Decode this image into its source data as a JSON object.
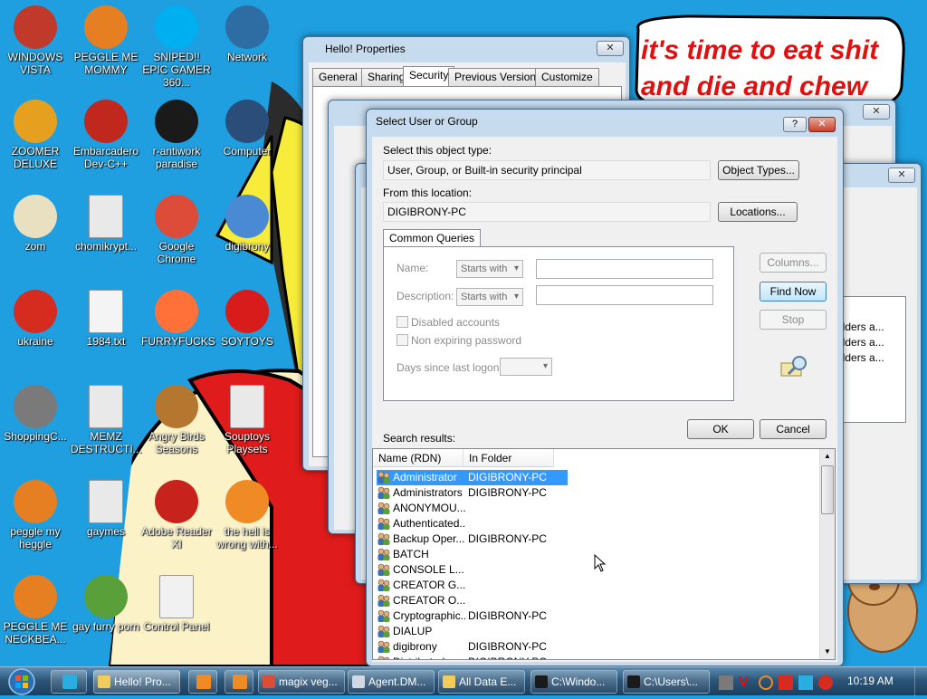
{
  "desktop_icons": [
    {
      "label": "WINDOWS VISTA",
      "icon": "vista-orb-icon",
      "color": "#c0392b"
    },
    {
      "label": "PEGGLE ME MOMMY",
      "icon": "peggle-icon",
      "color": "#e67e22"
    },
    {
      "label": "SNIPED!! EPIC GAMER 360...",
      "icon": "skype-icon",
      "color": "#00aff0"
    },
    {
      "label": "Network",
      "icon": "network-globe-icon",
      "color": "#2e6da4"
    },
    {
      "label": "ZOOMER DELUXE",
      "icon": "zoomer-icon",
      "color": "#e5a020"
    },
    {
      "label": "Embarcadero Dev-C++",
      "icon": "devcpp-icon",
      "color": "#c0281d"
    },
    {
      "label": "r-antiwork paradise",
      "icon": "antiwork-icon",
      "color": "#1a1a1a"
    },
    {
      "label": "Computer",
      "icon": "computer-icon",
      "color": "#2b4d7a"
    },
    {
      "label": "zom",
      "icon": "flower-icon",
      "color": "#e8e0c0"
    },
    {
      "label": "chomikrypt...",
      "icon": "chomikrypt-file-icon",
      "color": "#e9e9e9"
    },
    {
      "label": "Google Chrome",
      "icon": "chrome-icon",
      "color": "#dd4b39"
    },
    {
      "label": "digibrony",
      "icon": "user-folder-icon",
      "color": "#4a8ad4"
    },
    {
      "label": "ukraine",
      "icon": "radiation-icon",
      "color": "#d62b1f"
    },
    {
      "label": "1984.txt",
      "icon": "text-file-icon",
      "color": "#f4f4f4"
    },
    {
      "label": "FURRYFUCKS",
      "icon": "firefox-icon",
      "color": "#ff7139"
    },
    {
      "label": "SOYTOYS",
      "icon": "soytoys-icon",
      "color": "#d81b1b"
    },
    {
      "label": "ShoppingC...",
      "icon": "flash-icon",
      "color": "#7a7a7a"
    },
    {
      "label": "MEMZ DESTRUCTI...",
      "icon": "memz-file-icon",
      "color": "#e9e9e9"
    },
    {
      "label": "Angry Birds Seasons",
      "icon": "angry-birds-icon",
      "color": "#b5772f"
    },
    {
      "label": "Souptoys Playsets",
      "icon": "souptoys-file-icon",
      "color": "#e9e9e9"
    },
    {
      "label": "peggle my heggle",
      "icon": "peggle-icon",
      "color": "#e67e22"
    },
    {
      "label": "gaymes",
      "icon": "media-file-icon",
      "color": "#e9e9e9"
    },
    {
      "label": "Adobe Reader XI",
      "icon": "adobe-reader-icon",
      "color": "#c8221c"
    },
    {
      "label": "the hell is wrong with...",
      "icon": "uc-browser-icon",
      "color": "#f08a24"
    },
    {
      "label": "PEGGLE ME NECKBEA...",
      "icon": "peggle-icon",
      "color": "#e67e22"
    },
    {
      "label": "gay furry porn",
      "icon": "box-hamster-icon",
      "color": "#5aa03a"
    },
    {
      "label": "Control Panel",
      "icon": "control-panel-icon",
      "color": "#f1f1f1"
    }
  ],
  "speech_bubble": {
    "line1": "it's time to eat shit",
    "line2": "and die and chew"
  },
  "properties_window": {
    "title": "Hello! Properties",
    "tabs": [
      "General",
      "Sharing",
      "Security",
      "Previous Versions",
      "Customize"
    ],
    "active_tab": "Security"
  },
  "bg_right_window": {
    "snippets": [
      "olders a...",
      "olders a...",
      "olders a..."
    ]
  },
  "dialog": {
    "title": "Select User or Group",
    "help_label": "?",
    "object_type_label": "Select this object type:",
    "object_type_value": "User, Group, or Built-in security principal",
    "object_types_button": "Object Types...",
    "location_label": "From this location:",
    "location_value": "DIGIBRONY-PC",
    "locations_button": "Locations...",
    "tab_label": "Common Queries",
    "name_label": "Name:",
    "name_mode": "Starts with",
    "description_label": "Description:",
    "description_mode": "Starts with",
    "disabled_accounts": "Disabled accounts",
    "non_expiring": "Non expiring password",
    "days_label": "Days since last logon:",
    "columns_button": "Columns...",
    "find_now_button": "Find Now",
    "stop_button": "Stop",
    "ok_button": "OK",
    "cancel_button": "Cancel",
    "results_label": "Search results:",
    "columns": [
      "Name (RDN)",
      "In Folder"
    ],
    "results": [
      {
        "name": "Administrator",
        "folder": "DIGIBRONY-PC",
        "selected": true
      },
      {
        "name": "Administrators",
        "folder": "DIGIBRONY-PC"
      },
      {
        "name": "ANONYMOU...",
        "folder": ""
      },
      {
        "name": "Authenticated...",
        "folder": ""
      },
      {
        "name": "Backup Oper...",
        "folder": "DIGIBRONY-PC"
      },
      {
        "name": "BATCH",
        "folder": ""
      },
      {
        "name": "CONSOLE L...",
        "folder": ""
      },
      {
        "name": "CREATOR G...",
        "folder": ""
      },
      {
        "name": "CREATOR O...",
        "folder": ""
      },
      {
        "name": "Cryptographic...",
        "folder": "DIGIBRONY-PC"
      },
      {
        "name": "DIALUP",
        "folder": ""
      },
      {
        "name": "digibrony",
        "folder": "DIGIBRONY-PC"
      },
      {
        "name": "Distributed ...",
        "folder": "DIGIBRONY-PC"
      }
    ]
  },
  "taskbar": {
    "items": [
      {
        "label": "",
        "icon": "ie-icon"
      },
      {
        "label": "Hello! Pro...",
        "icon": "folder-icon",
        "active": true
      },
      {
        "label": "",
        "icon": "media-player-icon"
      },
      {
        "label": "",
        "icon": "uc-browser-icon"
      },
      {
        "label": "magix veg...",
        "icon": "chrome-icon"
      },
      {
        "label": "Agent.DM...",
        "icon": "window-icon"
      },
      {
        "label": "All Data E...",
        "icon": "folder-icon"
      },
      {
        "label": "C:\\Windo...",
        "icon": "cmd-icon"
      },
      {
        "label": "C:\\Users\\...",
        "icon": "cmd-icon"
      }
    ],
    "clock": "10:19 AM"
  }
}
